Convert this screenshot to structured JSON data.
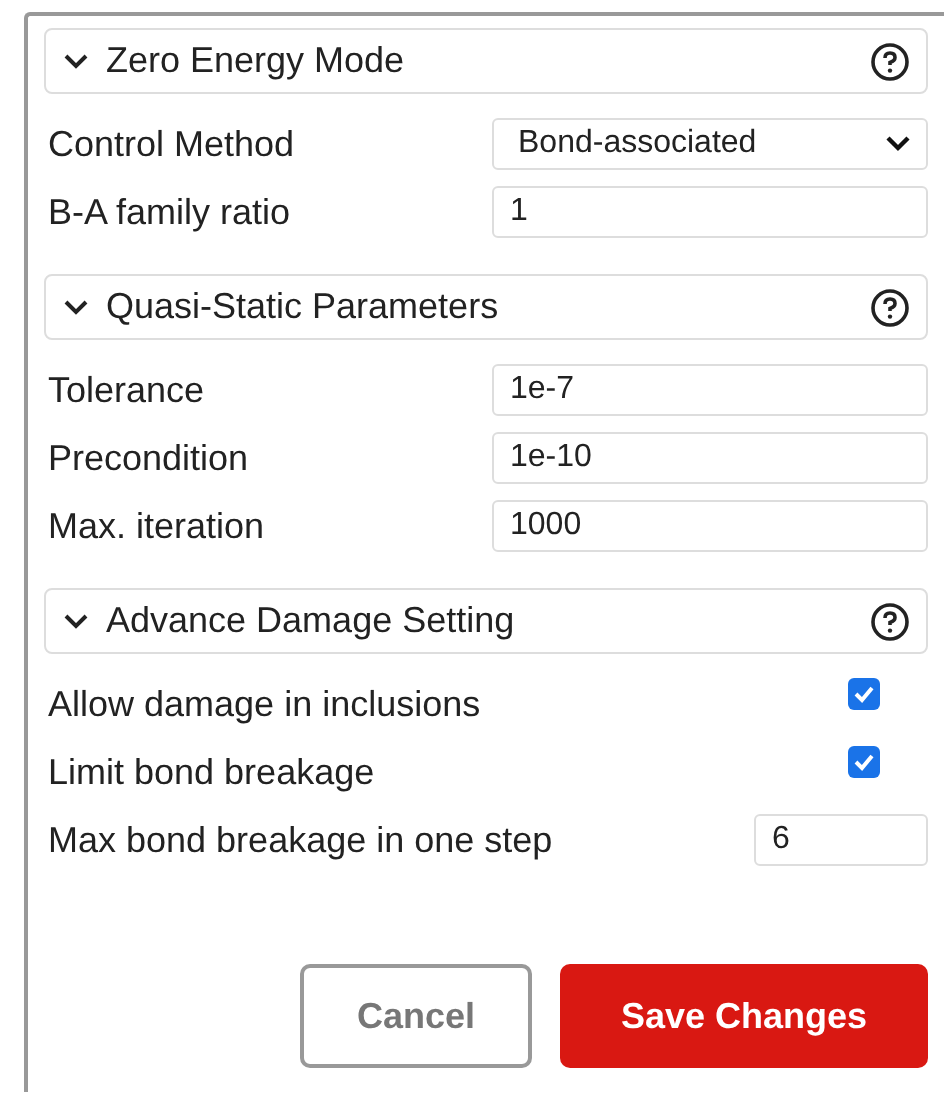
{
  "sections": [
    {
      "title": "Zero Energy Mode",
      "expanded": true,
      "fields": [
        {
          "kind": "select",
          "label": "Control Method",
          "value": "Bond-associated"
        },
        {
          "kind": "input",
          "label": "B-A family ratio",
          "value": "1"
        }
      ]
    },
    {
      "title": "Quasi-Static Parameters",
      "expanded": true,
      "fields": [
        {
          "kind": "input",
          "label": "Tolerance",
          "value": "1e-7"
        },
        {
          "kind": "input",
          "label": "Precondition",
          "value": "1e-10"
        },
        {
          "kind": "input",
          "label": "Max. iteration",
          "value": "1000"
        }
      ]
    },
    {
      "title": "Advance Damage Setting",
      "expanded": true,
      "fields": [
        {
          "kind": "checkbox",
          "label": "Allow damage in inclusions",
          "checked": true
        },
        {
          "kind": "checkbox",
          "label": "Limit bond breakage",
          "checked": true
        },
        {
          "kind": "short_input",
          "label": "Max bond breakage in one step",
          "value": "6"
        }
      ]
    }
  ],
  "buttons": [
    {
      "kind": "secondary",
      "label": "Cancel"
    },
    {
      "kind": "primary",
      "label": "Save Changes"
    }
  ]
}
